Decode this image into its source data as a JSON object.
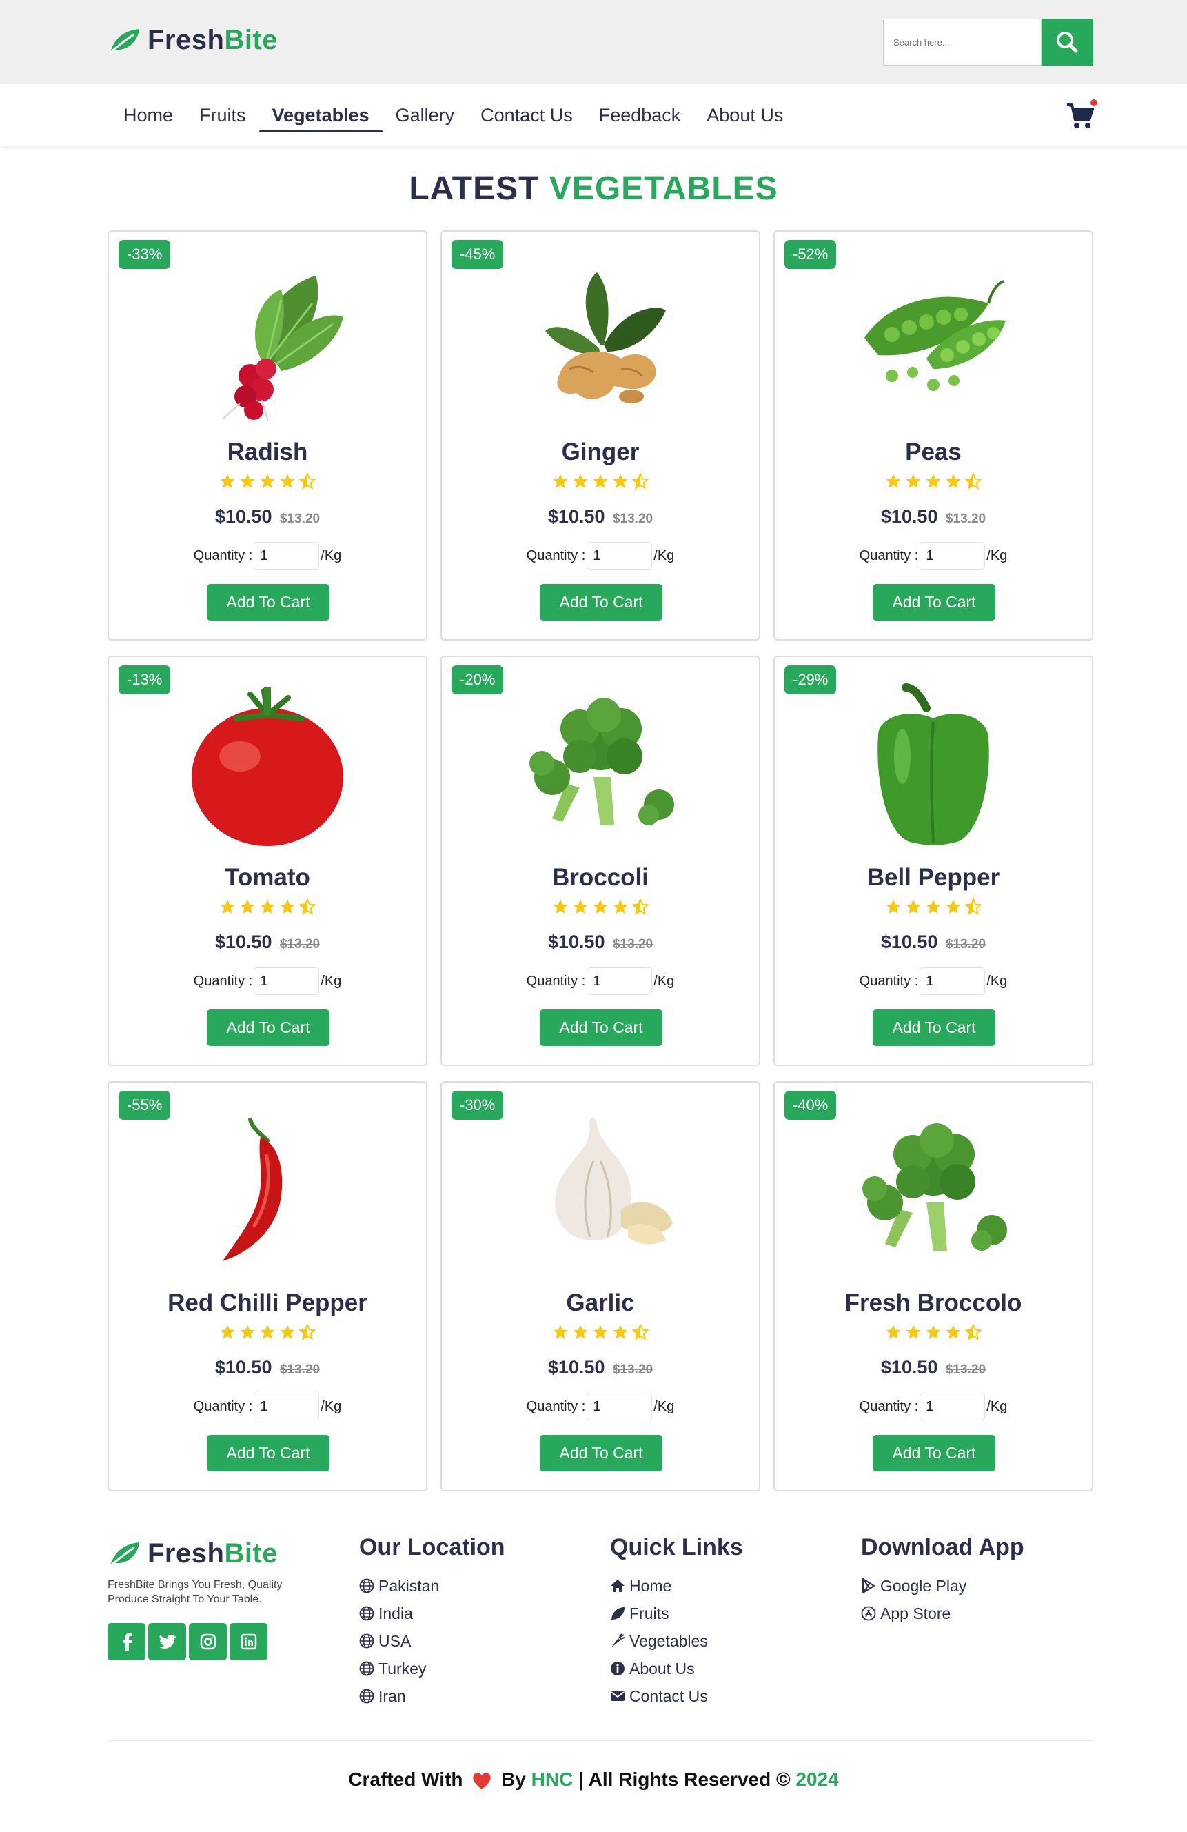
{
  "brand": {
    "name_part1": "Fresh",
    "name_part2": "Bite"
  },
  "search": {
    "placeholder": "Search here..."
  },
  "nav": {
    "items": [
      {
        "label": "Home"
      },
      {
        "label": "Fruits"
      },
      {
        "label": "Vegetables",
        "active": true
      },
      {
        "label": "Gallery"
      },
      {
        "label": "Contact Us"
      },
      {
        "label": "Feedback"
      },
      {
        "label": "About Us"
      }
    ]
  },
  "section": {
    "title_part1": "LATEST",
    "title_part2": "VEGETABLES"
  },
  "products": [
    {
      "name": "Radish",
      "discount": "-33%",
      "price": "$10.50",
      "old_price": "$13.20",
      "rating": 4.5,
      "qty_label": "Quantity :",
      "qty": "1",
      "unit": "/Kg",
      "button": "Add To Cart",
      "image": "radish"
    },
    {
      "name": "Ginger",
      "discount": "-45%",
      "price": "$10.50",
      "old_price": "$13.20",
      "rating": 4.5,
      "qty_label": "Quantity :",
      "qty": "1",
      "unit": "/Kg",
      "button": "Add To Cart",
      "image": "ginger"
    },
    {
      "name": "Peas",
      "discount": "-52%",
      "price": "$10.50",
      "old_price": "$13.20",
      "rating": 4.5,
      "qty_label": "Quantity :",
      "qty": "1",
      "unit": "/Kg",
      "button": "Add To Cart",
      "image": "peas"
    },
    {
      "name": "Tomato",
      "discount": "-13%",
      "price": "$10.50",
      "old_price": "$13.20",
      "rating": 4.5,
      "qty_label": "Quantity :",
      "qty": "1",
      "unit": "/Kg",
      "button": "Add To Cart",
      "image": "tomato"
    },
    {
      "name": "Broccoli",
      "discount": "-20%",
      "price": "$10.50",
      "old_price": "$13.20",
      "rating": 4.5,
      "qty_label": "Quantity :",
      "qty": "1",
      "unit": "/Kg",
      "button": "Add To Cart",
      "image": "broccoli"
    },
    {
      "name": "Bell Pepper",
      "discount": "-29%",
      "price": "$10.50",
      "old_price": "$13.20",
      "rating": 4.5,
      "qty_label": "Quantity :",
      "qty": "1",
      "unit": "/Kg",
      "button": "Add To Cart",
      "image": "bell-pepper"
    },
    {
      "name": "Red Chilli Pepper",
      "discount": "-55%",
      "price": "$10.50",
      "old_price": "$13.20",
      "rating": 4.5,
      "qty_label": "Quantity :",
      "qty": "1",
      "unit": "/Kg",
      "button": "Add To Cart",
      "image": "chilli"
    },
    {
      "name": "Garlic",
      "discount": "-30%",
      "price": "$10.50",
      "old_price": "$13.20",
      "rating": 4.5,
      "qty_label": "Quantity :",
      "qty": "1",
      "unit": "/Kg",
      "button": "Add To Cart",
      "image": "garlic"
    },
    {
      "name": "Fresh Broccolo",
      "discount": "-40%",
      "price": "$10.50",
      "old_price": "$13.20",
      "rating": 4.5,
      "qty_label": "Quantity :",
      "qty": "1",
      "unit": "/Kg",
      "button": "Add To Cart",
      "image": "broccoli"
    }
  ],
  "footer": {
    "tagline": "FreshBite Brings You Fresh, Quality Produce Straight To Your Table.",
    "socials": [
      "facebook-icon",
      "twitter-icon",
      "instagram-icon",
      "linkedin-icon"
    ],
    "location": {
      "title": "Our Location",
      "items": [
        "Pakistan",
        "India",
        "USA",
        "Turkey",
        "Iran"
      ]
    },
    "quick_links": {
      "title": "Quick Links",
      "items": [
        "Home",
        "Fruits",
        "Vegetables",
        "About Us",
        "Contact Us"
      ]
    },
    "download": {
      "title": "Download App",
      "items": [
        "Google Play",
        "App Store"
      ]
    },
    "copyright": {
      "part1": "Crafted With",
      "part2": "By",
      "author": "HNC",
      "part3": "| All Rights Reserved ©",
      "year": "2024"
    }
  },
  "colors": {
    "accent": "#27a85a",
    "text": "#2b2f4a",
    "star": "#f6c90e",
    "badge_dot": "#e53935"
  }
}
